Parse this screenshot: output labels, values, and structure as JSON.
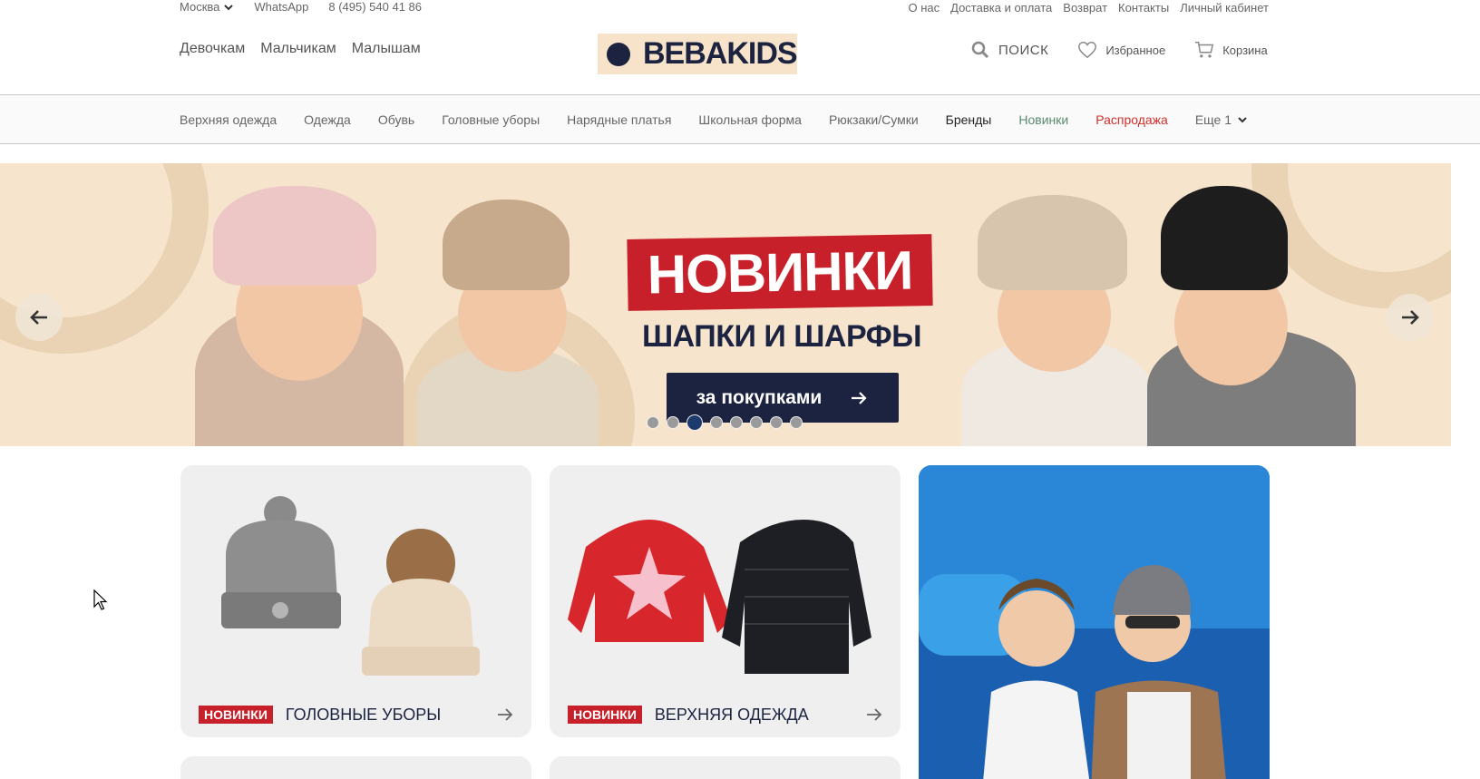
{
  "topbar": {
    "city": "Москва",
    "whatsapp": "WhatsApp",
    "phone": "8 (495) 540 41 86",
    "links": [
      "О нас",
      "Доставка и оплата",
      "Возврат",
      "Контакты",
      "Личный кабинет"
    ]
  },
  "header": {
    "gender_nav": [
      "Девочкам",
      "Мальчикам",
      "Малышам"
    ],
    "logo_text": "BEBAKIDS",
    "search_label": "ПОИСК",
    "favorites_label": "Избранное",
    "cart_label": "Корзина"
  },
  "categories": {
    "items": [
      "Верхняя одежда",
      "Одежда",
      "Обувь",
      "Головные уборы",
      "Нарядные платья",
      "Школьная форма",
      "Рюкзаки/Сумки"
    ],
    "brands": "Бренды",
    "new": "Новинки",
    "sale": "Распродажа",
    "more": "Еще 1"
  },
  "banner": {
    "title": "НОВИНКИ",
    "subtitle": "ШАПКИ И ШАРФЫ",
    "button_label": "за покупками",
    "slide_count": 8,
    "active_slide": 3
  },
  "cards": [
    {
      "badge": "НОВИНКИ",
      "title": "ГОЛОВНЫЕ УБОРЫ"
    },
    {
      "badge": "НОВИНКИ",
      "title": "ВЕРХНЯЯ ОДЕЖДА"
    }
  ],
  "colors": {
    "brand_navy": "#1c2340",
    "sale_red": "#d2302b",
    "new_green": "#5a8a6c",
    "banner_bg": "#f6e4cd"
  },
  "icons": [
    "chevron-down-icon",
    "search-icon",
    "heart-icon",
    "cart-icon",
    "arrow-left-icon",
    "arrow-right-icon"
  ]
}
